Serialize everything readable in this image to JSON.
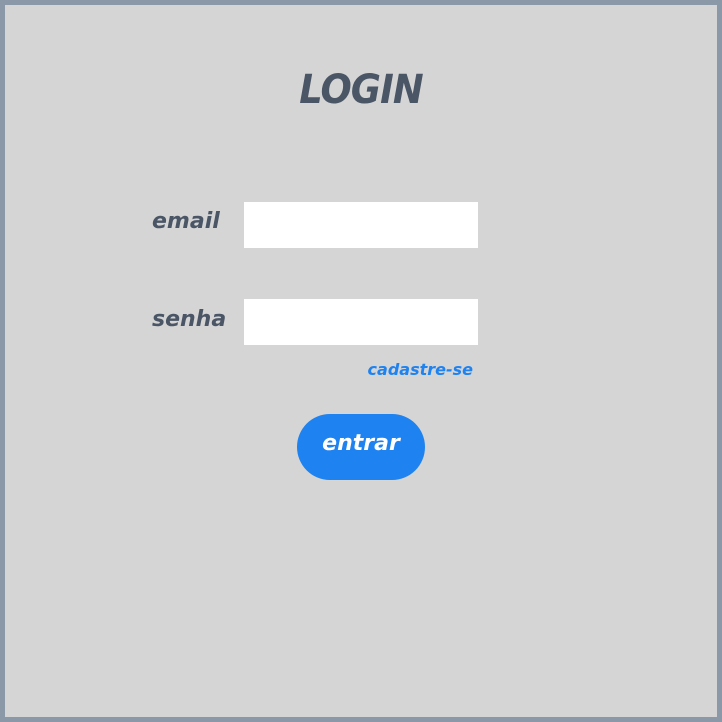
{
  "login": {
    "title": "LOGIN",
    "email_label": "email",
    "email_value": "",
    "password_label": "senha",
    "password_value": "",
    "signup_link": "cadastre-se",
    "submit_label": "entrar"
  },
  "colors": {
    "background": "#d5d5d5",
    "border": "#8a98a8",
    "text": "#4a5565",
    "accent": "#1e82f0",
    "field": "#ffffff"
  }
}
